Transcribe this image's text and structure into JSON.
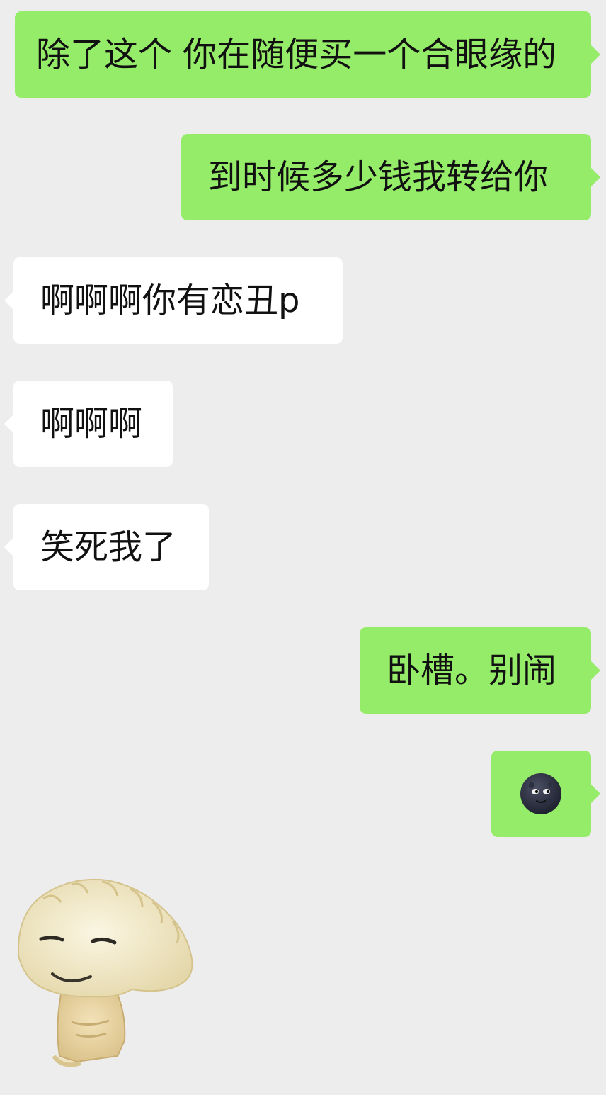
{
  "messages": [
    {
      "direction": "sent",
      "text": "除了这个 你在随便买一个合眼缘的"
    },
    {
      "direction": "sent",
      "text": "到时候多少钱我转给你"
    },
    {
      "direction": "received",
      "text": "啊啊啊你有恋丑p"
    },
    {
      "direction": "received",
      "text": "啊啊啊"
    },
    {
      "direction": "received",
      "text": "笑死我了"
    },
    {
      "direction": "sent",
      "text": "卧槽。别闹"
    },
    {
      "direction": "sent",
      "emoji": "new-moon-face-icon"
    },
    {
      "direction": "received",
      "sticker": "dumpling-sticker"
    }
  ],
  "colors": {
    "background": "#ededed",
    "sent_bubble": "#95ec69",
    "received_bubble": "#ffffff",
    "text": "#111111"
  }
}
